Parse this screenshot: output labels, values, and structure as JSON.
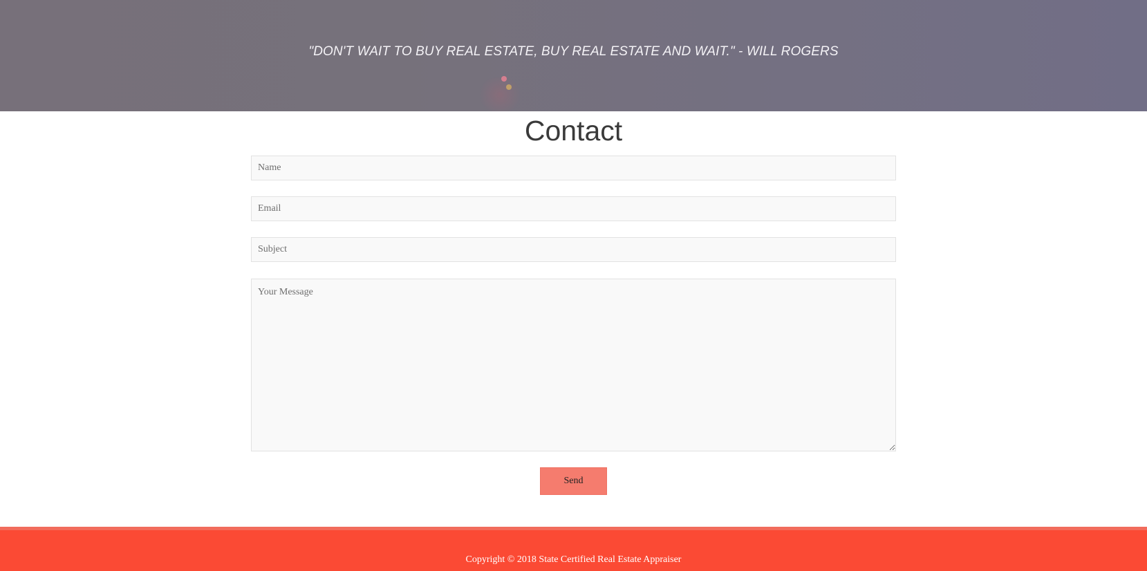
{
  "hero": {
    "quote": "\"DON'T WAIT TO BUY REAL ESTATE, BUY REAL ESTATE AND WAIT.\" - WILL ROGERS"
  },
  "contact": {
    "title": "Contact",
    "name_placeholder": "Name",
    "email_placeholder": "Email",
    "subject_placeholder": "Subject",
    "message_placeholder": "Your Message",
    "send_label": "Send"
  },
  "footer": {
    "copyright": "Copyright © 2018 State Certified Real Estate Appraiser"
  },
  "colors": {
    "accent": "#fb4a34",
    "button": "#f57c6e"
  }
}
